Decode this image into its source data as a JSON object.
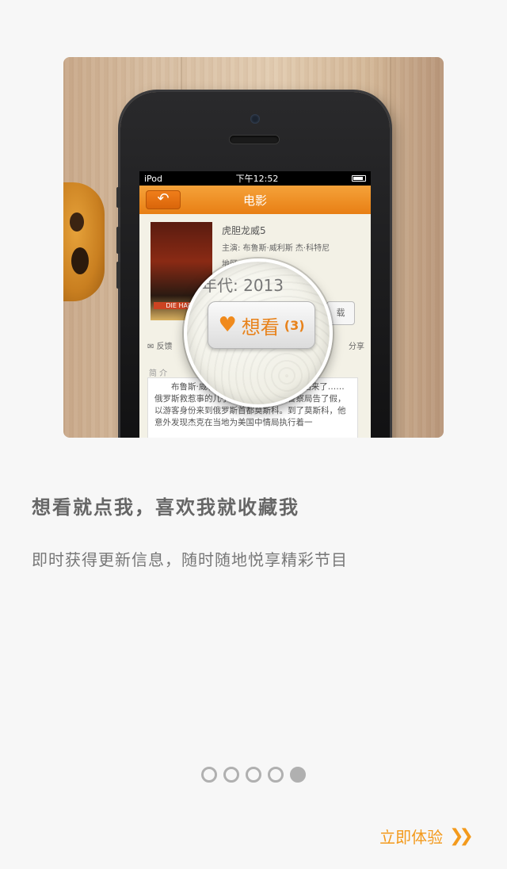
{
  "hero": {
    "phone": {
      "status": {
        "carrier": "iPod",
        "time": "下午12:52"
      },
      "nav": {
        "back_icon": "back-arrow-icon",
        "title": "电影"
      },
      "movie": {
        "title": "虎胆龙威5",
        "cast": "主演: 布鲁斯·威利斯 杰·科特尼",
        "area": "地区",
        "poster_text": "DIE HARD",
        "side_button": "载"
      },
      "actions": {
        "feedback": "反馈",
        "share": "分享"
      },
      "intro": {
        "label": "简 介",
        "text": "布鲁斯·威利斯 (0) \"约翰麦克莱恩又回来了……俄罗斯救惹事的儿子杰克出监狱，何警察局告了假，以游客身份来到俄罗斯首都莫斯科。到了莫斯科，他意外发现杰克在当地为美国中情局执行着一"
      },
      "magnifier": {
        "year": "年代: 2013",
        "want_label": "想看",
        "want_count": "(3)",
        "heart_icon": "heart-plus-icon"
      }
    }
  },
  "content": {
    "headline": "想看就点我，喜欢我就收藏我",
    "subline": "即时获得更新信息，随时随地悦享精彩节目"
  },
  "pager": {
    "total": 5,
    "active_index": 4
  },
  "cta": {
    "label": "立即体验",
    "icon": "double-chevron-right-icon"
  },
  "colors": {
    "accent": "#f39a1c",
    "nav_orange": "#e87f14",
    "text_gray": "#666666"
  }
}
